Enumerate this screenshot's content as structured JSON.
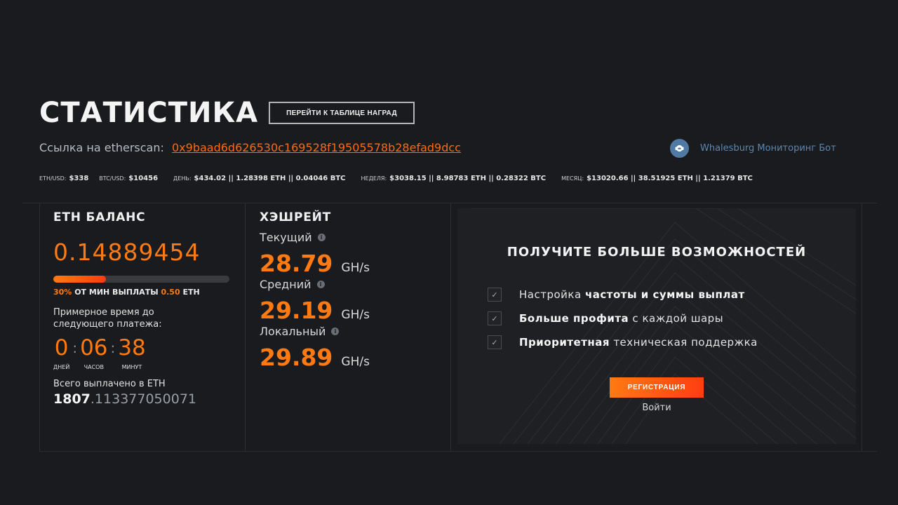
{
  "header": {
    "title": "СТАТИСТИКА",
    "rewards_button": "ПЕРЕЙТИ К ТАБЛИЦЕ НАГРАД",
    "etherscan_label": "Ссылка на etherscan:",
    "etherscan_address": "0x9baad6d626530c169528f19505578b28efad9dcc",
    "bot_label": "Whalesburg Мониторинг Бот",
    "bot_icon": "robot-icon"
  },
  "ticker": [
    {
      "label": "ETH/USD:",
      "value": "$338"
    },
    {
      "label": "BTC/USD:",
      "value": "$10456"
    },
    {
      "label": "ДЕНЬ:",
      "value": "$434.02 || 1.28398 ETH || 0.04046 BTC"
    },
    {
      "label": "НЕДЕЛЯ:",
      "value": "$3038.15 || 8.98783 ETH || 0.28322 BTC"
    },
    {
      "label": "МЕСЯЦ:",
      "value": "$13020.66 || 38.51925 ETH || 1.21379 BTC"
    }
  ],
  "balance": {
    "title": "ETH БАЛАНС",
    "value": "0.14889454",
    "progress_fraction": 0.3,
    "percent": "30%",
    "from_min_text": "ОТ МИН ВЫПЛАТЫ",
    "min_payout": "0.50",
    "currency": "ETH",
    "eta_label": "Примерное время до следующего платежа:",
    "timer": {
      "days": "0",
      "days_label": "ДНЕЙ",
      "hours": "06",
      "hours_label": "ЧАСОВ",
      "minutes": "38",
      "minutes_label": "МИНУТ"
    },
    "paid_label": "Всего выплачено в ETH",
    "paid_int": "1807",
    "paid_frac": ".113377050071"
  },
  "hashrate": {
    "title": "ХЭШРЕЙТ",
    "rows": [
      {
        "label": "Текущий",
        "value": "28.79",
        "unit": "GH/s"
      },
      {
        "label": "Средний",
        "value": "29.19",
        "unit": "GH/s"
      },
      {
        "label": "Локальный",
        "value": "29.89",
        "unit": "GH/s"
      }
    ]
  },
  "promo": {
    "title": "ПОЛУЧИТЕ БОЛЬШЕ ВОЗМОЖНОСТЕЙ",
    "features": [
      {
        "pre": "Настройка ",
        "bold": "частоты и суммы выплат",
        "post": ""
      },
      {
        "pre": "",
        "bold": "Больше профита",
        "post": " с каждой шары"
      },
      {
        "pre": "",
        "bold": "Приоритетная",
        "post": " техническая поддержка"
      }
    ],
    "register_button": "РЕГИСТРАЦИЯ",
    "login_link": "Войти"
  },
  "colors": {
    "accent": "#ff7a12",
    "background": "#1a1b1e",
    "link_blue": "#5e86ad"
  }
}
